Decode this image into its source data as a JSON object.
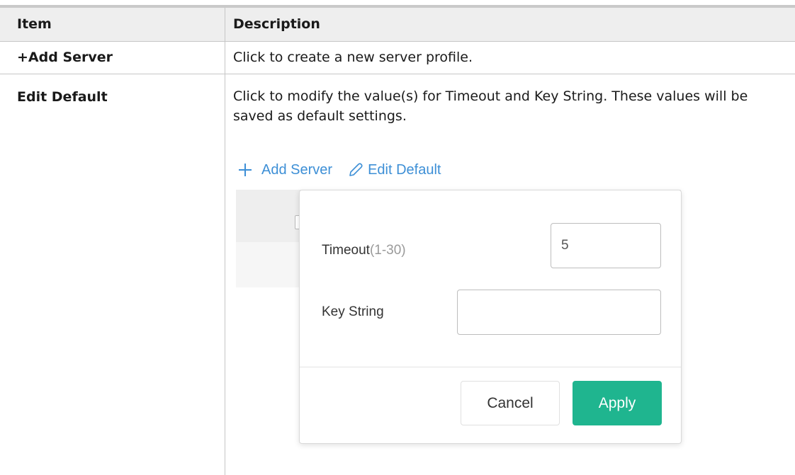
{
  "table": {
    "header": {
      "item": "Item",
      "description": "Description"
    },
    "rows": [
      {
        "item": "+Add Server",
        "description": "Click to create a new server profile."
      },
      {
        "item": "Edit Default",
        "description": "Click to modify the value(s) for Timeout and Key String. These values will be saved as default settings."
      }
    ]
  },
  "ui_example": {
    "toolbar": {
      "add_label": "Add Server",
      "add_icon": "plus-icon",
      "edit_label": "Edit Default",
      "edit_icon": "pencil-icon",
      "link_color": "#3d8fd6"
    },
    "popover": {
      "timeout_label": "Timeout",
      "timeout_range": "(1-30)",
      "timeout_value": "5",
      "key_string_label": "Key String",
      "key_string_value": "",
      "cancel_label": "Cancel",
      "apply_label": "Apply",
      "apply_color": "#1fb58f"
    }
  }
}
